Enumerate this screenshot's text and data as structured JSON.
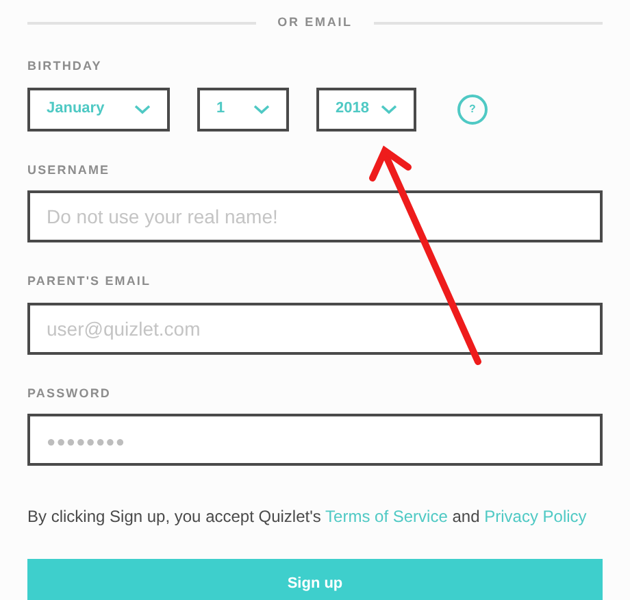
{
  "divider": {
    "label": "OR EMAIL"
  },
  "birthday": {
    "label": "BIRTHDAY",
    "selects": [
      {
        "value": "January"
      },
      {
        "value": "1"
      },
      {
        "value": "2018"
      }
    ],
    "help": "?"
  },
  "fields": [
    {
      "label": "USERNAME",
      "placeholder": "Do not use your real name!"
    },
    {
      "label": "PARENT'S EMAIL",
      "placeholder": "user@quizlet.com"
    },
    {
      "label": "PASSWORD",
      "placeholder": "●●●●●●●●"
    }
  ],
  "terms": {
    "text": "By clicking Sign up, you accept Quizlet's",
    "link1": "Terms of Service",
    "joiner": "and",
    "link2": "Privacy Policy"
  },
  "submit": {
    "label": "Sign up"
  }
}
